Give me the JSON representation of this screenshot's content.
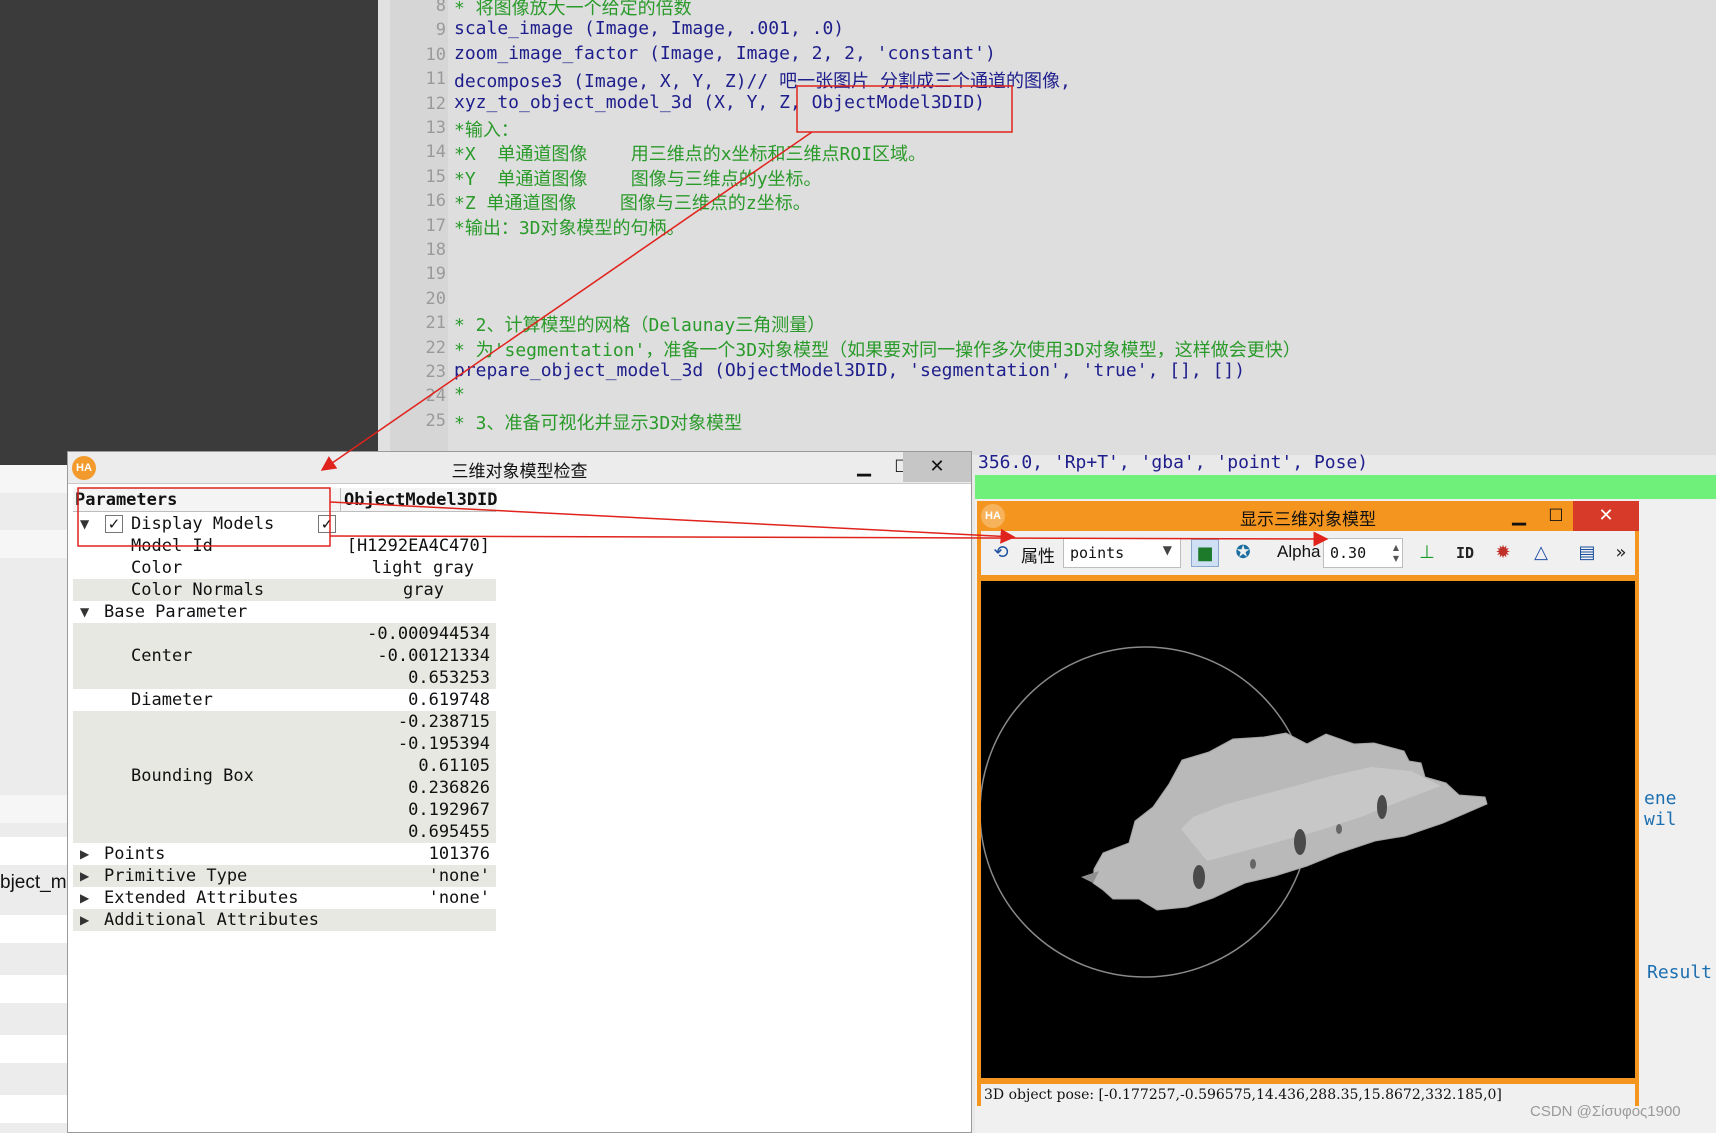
{
  "editor": {
    "lines": [
      {
        "num": "8",
        "text": "* 将图像放大一个给定的倍数",
        "kind": "comment"
      },
      {
        "num": "9",
        "text": "scale_image (Image, Image, .001, .0)",
        "kind": "code"
      },
      {
        "num": "10",
        "text": "zoom_image_factor (Image, Image, 2, 2, 'constant')",
        "kind": "code"
      },
      {
        "num": "11",
        "text": "decompose3 (Image, X, Y, Z)// 吧一张图片 分割成三个通道的图像,",
        "kind": "code"
      },
      {
        "num": "12",
        "text": "xyz_to_object_model_3d (X, Y, Z, ObjectModel3DID)",
        "kind": "code"
      },
      {
        "num": "13",
        "text": "*输入：",
        "kind": "comment"
      },
      {
        "num": "14",
        "text": "*X  单通道图像    用三维点的x坐标和三维点ROI区域。",
        "kind": "comment"
      },
      {
        "num": "15",
        "text": "*Y  单通道图像    图像与三维点的y坐标。",
        "kind": "comment"
      },
      {
        "num": "16",
        "text": "*Z 单通道图像    图像与三维点的z坐标。",
        "kind": "comment"
      },
      {
        "num": "17",
        "text": "*输出：3D对象模型的句柄。",
        "kind": "comment"
      },
      {
        "num": "18",
        "text": "",
        "kind": "code"
      },
      {
        "num": "19",
        "text": "",
        "kind": "code"
      },
      {
        "num": "20",
        "text": "",
        "kind": "code"
      },
      {
        "num": "21",
        "text": "* 2、计算模型的网格（Delaunay三角测量）",
        "kind": "comment"
      },
      {
        "num": "22",
        "text": "* 为'segmentation'，准备一个3D对象模型（如果要对同一操作多次使用3D对象模型，这样做会更快）",
        "kind": "comment"
      },
      {
        "num": "23",
        "text": "prepare_object_model_3d (ObjectModel3DID, 'segmentation', 'true', [], [])",
        "kind": "code"
      },
      {
        "num": "24",
        "text": "*",
        "kind": "comment"
      },
      {
        "num": "25",
        "text": "* 3、准备可视化并显示3D对象模型",
        "kind": "comment"
      }
    ],
    "overflow_line": "356.0, 'Rp+T', 'gba', 'point', Pose)",
    "scene_fragment": "ene wil",
    "result_fragment": "Result"
  },
  "left_fragment": "bject_m",
  "inspect": {
    "title": "三维对象模型检查",
    "col_params": "Parameters",
    "col_value": "ObjectModel3DID",
    "display_models": {
      "label": "Display Models",
      "checked": true,
      "value_checked": true
    },
    "model_id": {
      "label": "Model Id",
      "value": "[H1292EA4C470]"
    },
    "color": {
      "label": "Color",
      "value": "light gray"
    },
    "color_normals": {
      "label": "Color Normals",
      "value": "gray"
    },
    "base_parameter": {
      "label": "Base Parameter"
    },
    "center": {
      "label": "Center",
      "values": [
        "-0.000944534",
        "-0.00121334",
        "0.653253"
      ]
    },
    "diameter": {
      "label": "Diameter",
      "value": "0.619748"
    },
    "bounding_box": {
      "label": "Bounding Box",
      "values": [
        "-0.238715",
        "-0.195394",
        "0.61105",
        "0.236826",
        "0.192967",
        "0.695455"
      ]
    },
    "points": {
      "label": "Points",
      "value": "101376"
    },
    "primitive_type": {
      "label": "Primitive Type",
      "value": "'none'"
    },
    "extended_attributes": {
      "label": "Extended Attributes",
      "value": "'none'"
    },
    "additional_attributes": {
      "label": "Additional Attributes"
    }
  },
  "viewer": {
    "title": "显示三维对象模型",
    "property_label": "属性",
    "property_value": "points",
    "alpha_label": "Alpha",
    "alpha_value": "0.30",
    "id_label": "ID",
    "status": "3D object pose: [-0.177257,-0.596575,14.436,288.35,15.8672,332.185,0]"
  },
  "watermark": "CSDN @Σίσυφος1900",
  "colors": {
    "highlight_red": "#e0231c",
    "viewer_frame": "#f4951f",
    "code_blue": "#1e1e8c",
    "comment_green": "#2a9a2a"
  }
}
